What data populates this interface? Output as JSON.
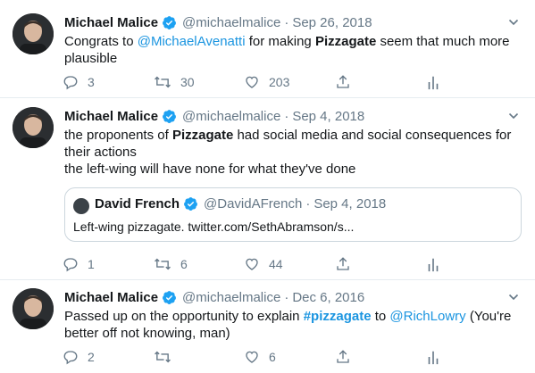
{
  "tweets": [
    {
      "author": "Michael Malice",
      "handle": "@michaelmalice",
      "date": "Sep 26, 2018",
      "text_parts": [
        "Congrats to ",
        "@MichaelAvenatti",
        " for making ",
        "Pizzagate",
        " seem that much more plausible"
      ],
      "replies": "3",
      "retweets": "30",
      "likes": "203"
    },
    {
      "author": "Michael Malice",
      "handle": "@michaelmalice",
      "date": "Sep 4, 2018",
      "text_parts": [
        "the proponents of ",
        "Pizzagate",
        " had social media and social consequences for their actions"
      ],
      "text_line2": "the left-wing will have none for what they've done",
      "quote": {
        "author": "David French",
        "handle": "@DavidAFrench",
        "date": "Sep 4, 2018",
        "text": "Left-wing pizzagate. twitter.com/SethAbramson/s..."
      },
      "replies": "1",
      "retweets": "6",
      "likes": "44"
    },
    {
      "author": "Michael Malice",
      "handle": "@michaelmalice",
      "date": "Dec 6, 2016",
      "text_parts": [
        "Passed up on the opportunity to explain ",
        "#pizzagate",
        " to ",
        "@RichLowry",
        " (You're better off not knowing, man)"
      ],
      "replies": "2",
      "retweets": "",
      "likes": "6"
    }
  ],
  "separator": "·",
  "icons": {
    "reply": "reply-icon",
    "retweet": "retweet-icon",
    "like": "heart-icon",
    "share": "share-icon",
    "analytics": "analytics-icon",
    "verified": "verified-badge-icon",
    "caret": "chevron-down-icon"
  },
  "colors": {
    "text": "#14171a",
    "muted": "#657786",
    "link": "#1b95e0",
    "verified": "#1da1f2",
    "border": "#e6ecf0"
  }
}
